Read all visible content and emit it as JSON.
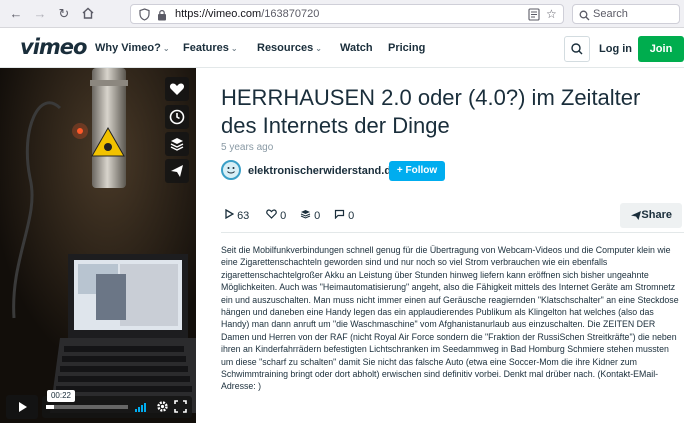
{
  "browser": {
    "url_host": "https://vimeo.com",
    "url_path": "/163870720",
    "search_placeholder": "Search"
  },
  "header": {
    "logo": "vimeo",
    "menu": [
      {
        "label": "Why Vimeo?",
        "has_dropdown": true
      },
      {
        "label": "Features",
        "has_dropdown": true
      },
      {
        "label": "Resources",
        "has_dropdown": true
      },
      {
        "label": "Watch",
        "has_dropdown": false
      },
      {
        "label": "Pricing",
        "has_dropdown": false
      }
    ],
    "login_label": "Log in",
    "join_label": "Join",
    "join_color": "#00ad4e"
  },
  "player": {
    "time": "00:22",
    "side_icons": [
      "heart-icon",
      "clock-icon",
      "layers-icon",
      "send-icon"
    ],
    "control_icons": [
      "volume-icon",
      "settings-icon",
      "fullscreen-icon"
    ]
  },
  "video": {
    "title": "HERRHAUSEN 2.0 oder (4.0?) im Zeitalter des Internets der Dinge",
    "posted": "5 years ago",
    "author": "elektronischerwiderstand.de",
    "follow_label": "+ Follow",
    "follow_color": "#00adef",
    "stats": {
      "plays": "63",
      "likes": "0",
      "collections": "0",
      "comments": "0"
    },
    "share_label": "Share",
    "description": "Seit die Mobilfunkverbindungen schnell genug für die Übertragung von Webcam-Videos und die Computer klein wie eine Zigarettenschachteln geworden sind und nur noch so viel Strom verbrauchen wie ein ebenfalls zigarettenschachtelgroßer Akku an Leistung über Stunden hinweg liefern kann eröffnen sich bisher ungeahnte Möglichkeiten. Auch was \"Heimautomatisierung\" angeht, also die Fähigkeit mittels des Internet Geräte am Stromnetz ein und auszuschalten. Man muss nicht immer einen auf Geräusche reagiernden \"Klatschschalter\" an eine Steckdose hängen und daneben eine Handy legen das ein applaudierendes Publikum als Klingelton hat welches (also das Handy) man dann anruft um \"die Waschmaschine\" vom Afghanistanurlaub aus einzuschalten. Die ZEITEN DER Damen und Herren von der RAF (nicht Royal Air Force sondern die \"Fraktion der RussiSchen Streitkräfte\") die neben ihren an Kinderfahrrädern befestigten Lichtschranken im Seedammweg in Bad Homburg Schmiere stehen mussten um diese \"scharf zu schalten\" damit Sie nicht das falsche Auto (etwa eine Soccer-Mom die ihre Kidner zum Schwimmtraining bringt oder dort abholt) erwischen sind definitiv vorbei. Denkt mal drüber nach. (Kontakt-EMail-Adresse: )"
  }
}
